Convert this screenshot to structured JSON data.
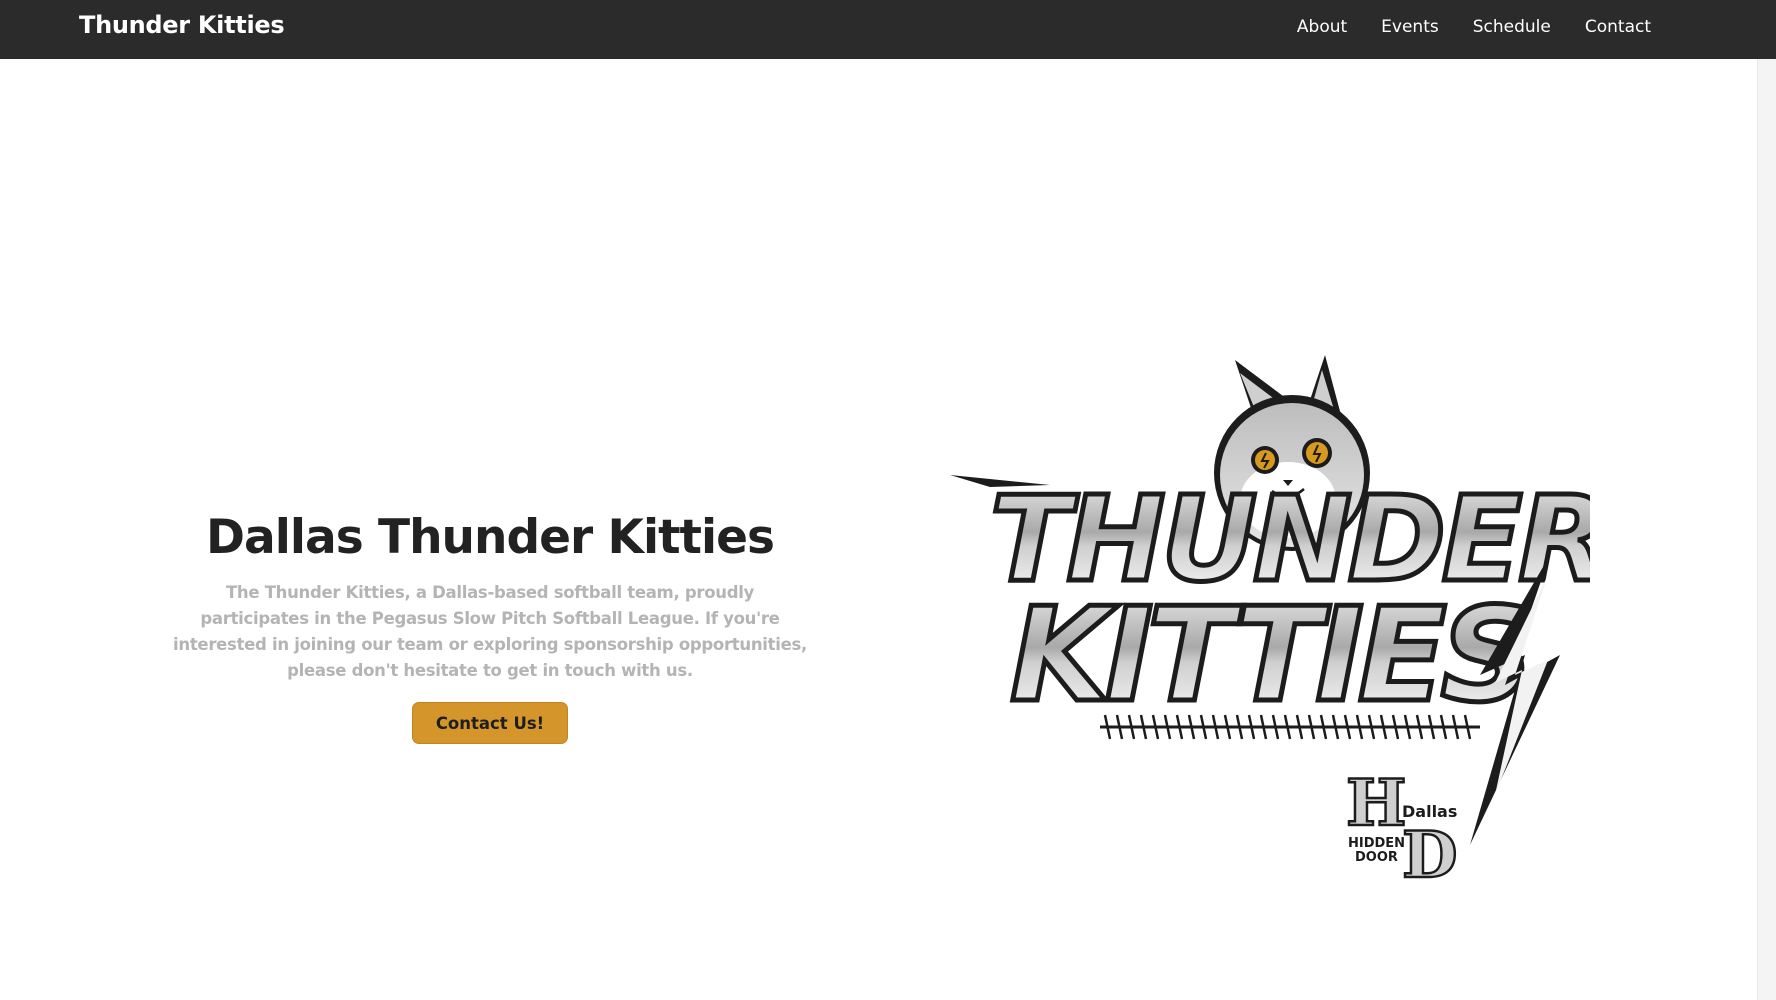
{
  "navbar": {
    "brand": "Thunder Kitties",
    "links": [
      {
        "label": "About"
      },
      {
        "label": "Events"
      },
      {
        "label": "Schedule"
      },
      {
        "label": "Contact"
      }
    ]
  },
  "hero": {
    "title": "Dallas Thunder Kitties",
    "description": "The Thunder Kitties, a Dallas-based softball team, proudly participates in the Pegasus Slow Pitch Softball League. If you're interested in joining our team or exploring sponsorship opportunities, please don't hesitate to get in touch with us.",
    "cta_label": "Contact Us!"
  },
  "logo": {
    "line1": "THUNDER",
    "line2": "KITTIES",
    "sponsor_letter_h": "H",
    "sponsor_letter_d": "D",
    "sponsor_city": "Dallas",
    "sponsor_word1": "HIDDEN",
    "sponsor_word2": "DOOR"
  },
  "colors": {
    "navbar_bg": "#2b2b2b",
    "accent": "#d4962a",
    "text_dark": "#222222",
    "text_muted": "#b4b4b4"
  }
}
